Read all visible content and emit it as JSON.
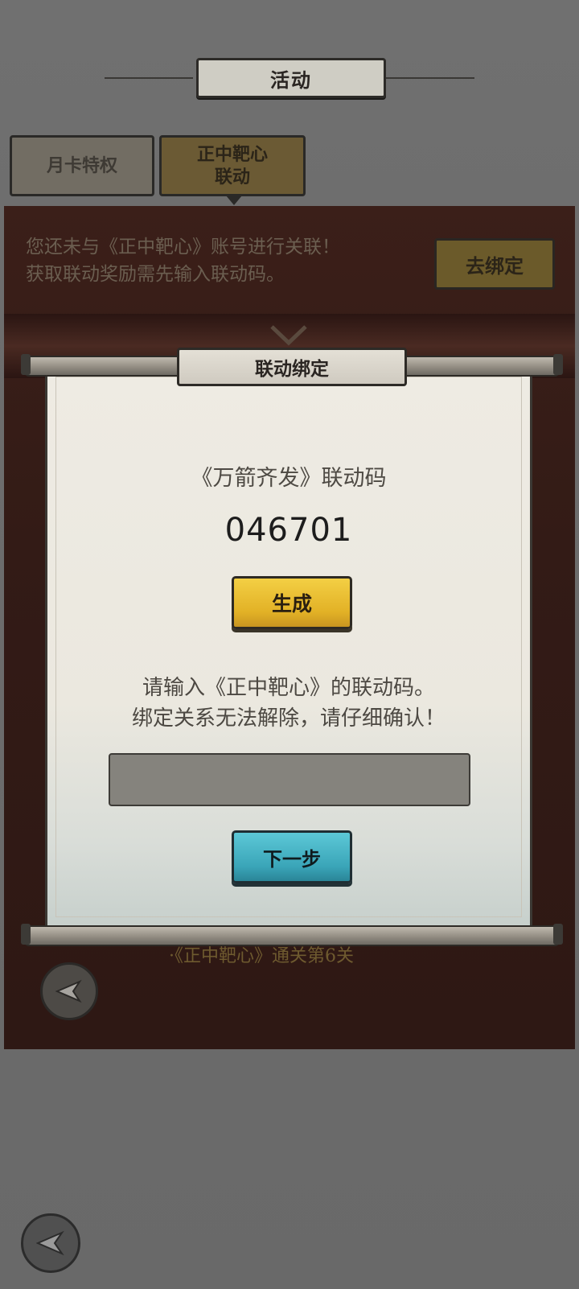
{
  "header": {
    "title": "活动"
  },
  "tabs": [
    {
      "label": "月卡特权",
      "active": false
    },
    {
      "label": "正中靶心\n联动",
      "active": true
    }
  ],
  "notice": {
    "text_line1": "您还未与《正中靶心》账号进行关联！",
    "text_line2": "获取联动奖励需先输入联动码。",
    "bind_button": "去绑定"
  },
  "task_hint": "·《正中靶心》通关第6关",
  "modal": {
    "title": "联动绑定",
    "code_label": "《万箭齐发》联动码",
    "code_value": "046701",
    "generate_button": "生成",
    "instruction_line1": "请输入《正中靶心》的联动码。",
    "instruction_line2": "绑定关系无法解除，请仔细确认！",
    "input_value": "",
    "input_placeholder": "",
    "next_button": "下一步"
  },
  "icons": {
    "back": "back-arrow-icon",
    "collapse": "chevron-down-icon"
  },
  "colors": {
    "generate_button": "#e2b126",
    "next_button": "#3aa5b8",
    "panel": "#331b16"
  }
}
